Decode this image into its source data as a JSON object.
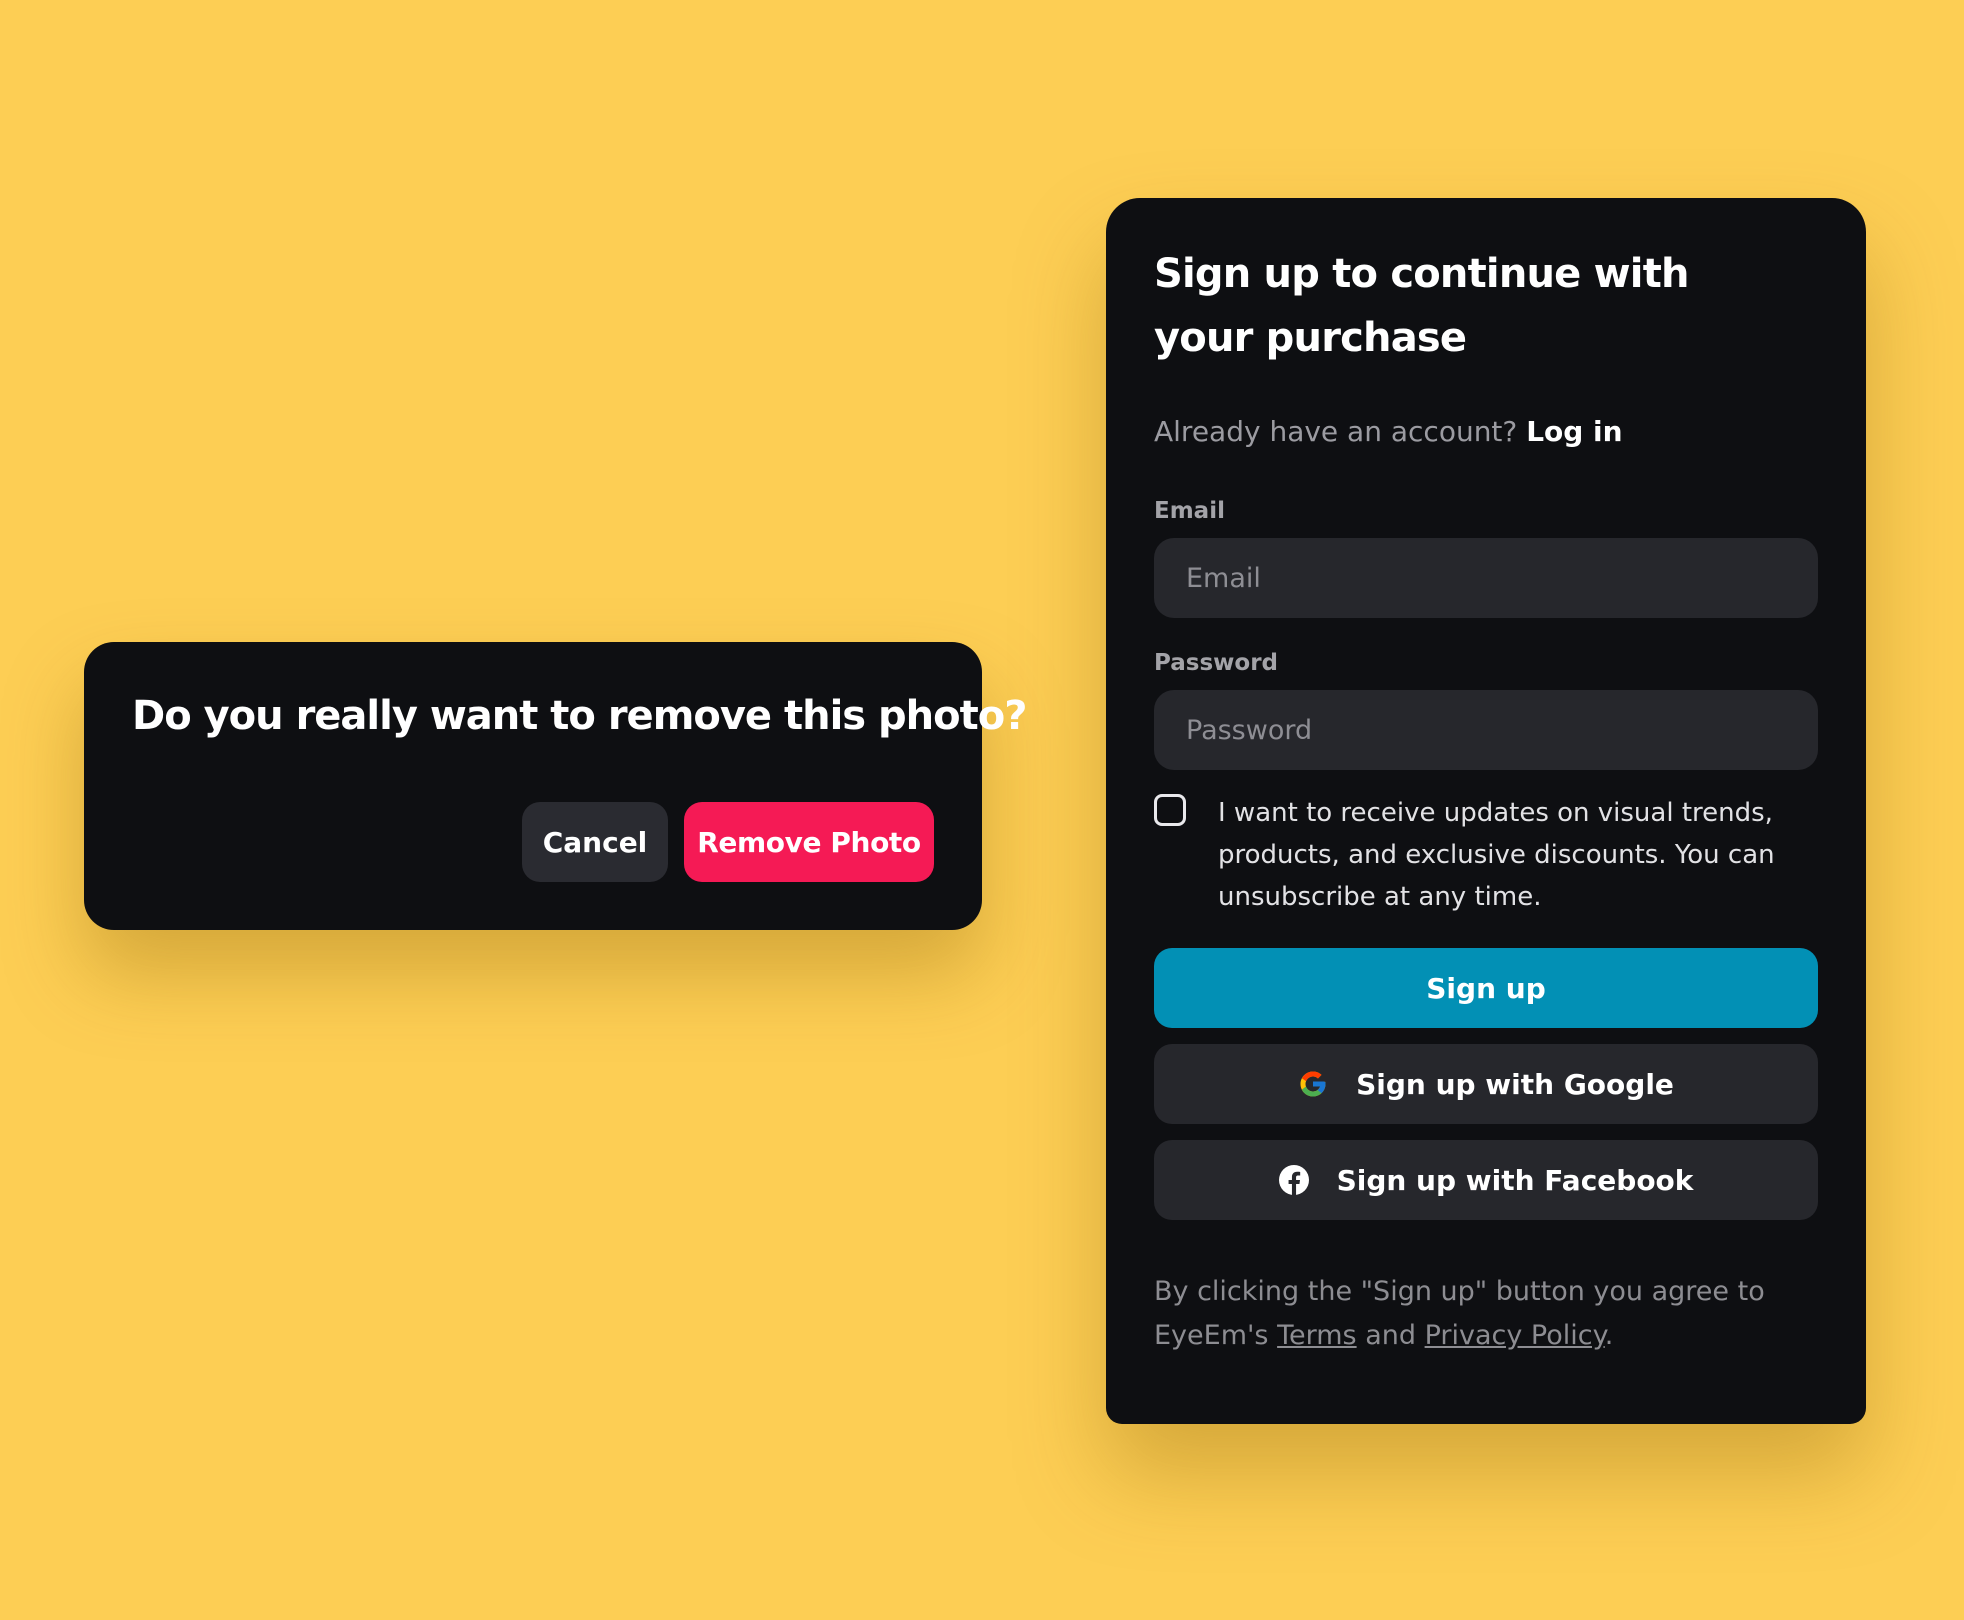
{
  "colors": {
    "background": "#fdce54",
    "card": "#0e0f12",
    "input": "#26272c",
    "danger": "#f51a55",
    "primary": "#0290b5"
  },
  "confirm_dialog": {
    "title": "Do you really want to remove this photo?",
    "cancel_label": "Cancel",
    "remove_label": "Remove Photo"
  },
  "signup": {
    "title": "Sign up to continue with your purchase",
    "login_prompt": "Already have an account?",
    "login_link": "Log in",
    "email_label": "Email",
    "email_placeholder": "Email",
    "email_value": "",
    "password_label": "Password",
    "password_placeholder": "Password",
    "password_value": "",
    "consent_checked": false,
    "consent_text": "I want to receive updates on visual trends, products, and exclusive discounts. You can unsubscribe at any time.",
    "signup_label": "Sign up",
    "google_label": "Sign up with Google",
    "google_icon": "google-icon",
    "facebook_label": "Sign up with Facebook",
    "facebook_icon": "facebook-icon",
    "legal_prefix": "By clicking the \"Sign up\" button you agree to EyeEm's",
    "terms_link": "Terms",
    "legal_and": "and",
    "privacy_link": "Privacy Policy",
    "legal_suffix": "."
  }
}
